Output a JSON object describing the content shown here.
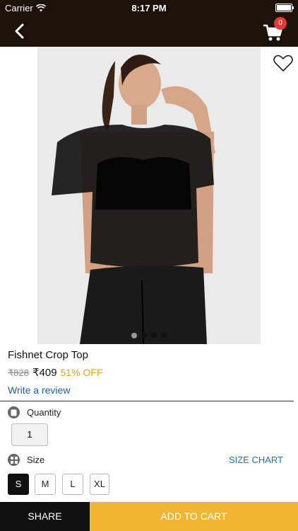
{
  "status_bar": {
    "carrier": "Carrier",
    "time": "8:17 PM",
    "battery_level": 1.0
  },
  "header": {
    "cart_count": "0"
  },
  "product": {
    "image_alt": "Fishnet Crop Top",
    "carousel": {
      "total": 4,
      "active_index": 0
    },
    "title": "Fishnet Crop Top",
    "original_price": "₹828",
    "price": "₹409",
    "discount": "51% OFF",
    "review_link": "Write a review"
  },
  "quantity": {
    "label": "Quantity",
    "value": "1"
  },
  "size": {
    "label": "Size",
    "chart_link": "SIZE CHART",
    "options": [
      "S",
      "M",
      "L",
      "XL"
    ],
    "selected": "S"
  },
  "actions": {
    "share": "SHARE",
    "add_to_cart": "ADD TO CART"
  },
  "colors": {
    "header_bg": "#1d1207",
    "accent": "#f2b731",
    "badge": "#e53935",
    "link": "#1a5fb4"
  }
}
